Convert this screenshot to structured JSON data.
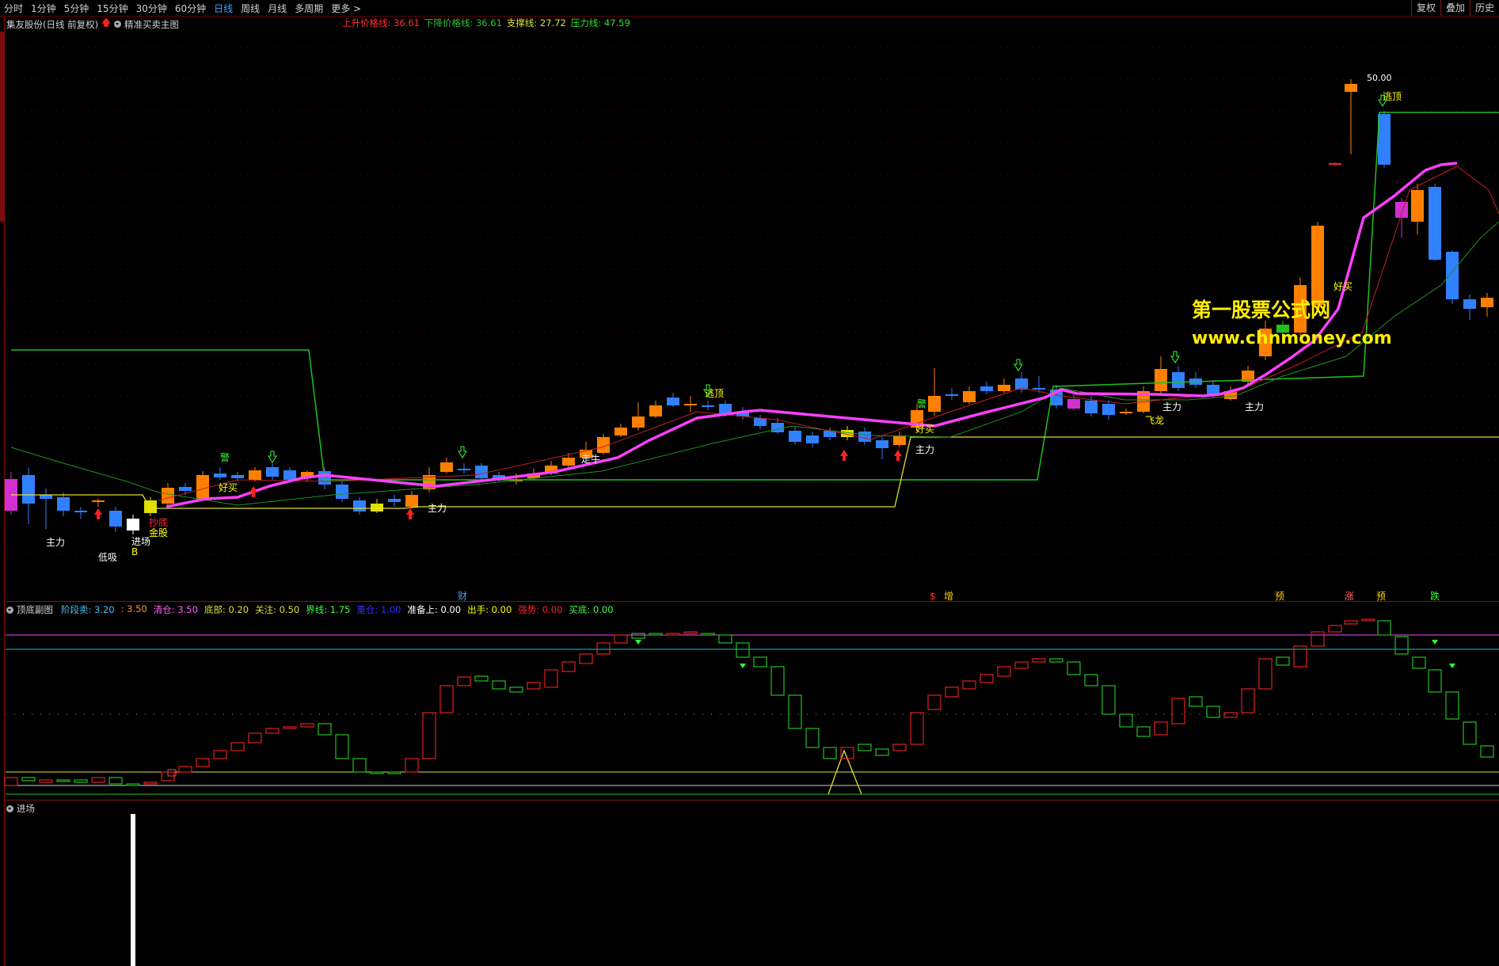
{
  "toolbar": {
    "tabs": [
      "分时",
      "1分钟",
      "5分钟",
      "15分钟",
      "30分钟",
      "60分钟",
      "日线",
      "周线",
      "月线",
      "多周期",
      "更多"
    ],
    "active": "日线",
    "right_buttons": [
      "复权",
      "叠加",
      "历史"
    ]
  },
  "main_panel": {
    "stock": "集友股份(日线 前复权)",
    "indicator": "精准买卖主图",
    "legend": [
      {
        "label": "上升价格线:",
        "value": "36.61",
        "color": "#ff3030"
      },
      {
        "label": "下降价格线:",
        "value": "36.61",
        "color": "#30c030"
      },
      {
        "label": "支撑线:",
        "value": "27.72",
        "color": "#e0e030"
      },
      {
        "label": "压力线:",
        "value": "47.59",
        "color": "#30e030"
      }
    ],
    "price_max_label": "50.00",
    "watermark_name": "第一股票公式网",
    "watermark_url": "www.chnmoney.com",
    "signals": [
      "主力",
      "低吸",
      "进场",
      "B",
      "金股",
      "抄底",
      "好买",
      "走牛",
      "逃顶",
      "主力",
      "好买",
      "主力",
      "飞龙",
      "主力",
      "好买",
      "逃顶",
      "主力",
      "警",
      "警"
    ],
    "bottom_markers": [
      "财",
      "$",
      "增",
      "预",
      "涨",
      "预",
      "跌"
    ]
  },
  "sub_panel": {
    "title": "顶底副图",
    "legend": [
      {
        "label": "阶段卖:",
        "value": "3.20",
        "color": "#40c0ff"
      },
      {
        "label": ":",
        "value": "3.50",
        "color": "#ff9040"
      },
      {
        "label": "清仓:",
        "value": "3.50",
        "color": "#ff60ff"
      },
      {
        "label": "底部:",
        "value": "0.20",
        "color": "#e0e030"
      },
      {
        "label": "关注:",
        "value": "0.50",
        "color": "#e0e030"
      },
      {
        "label": "界线:",
        "value": "1.75",
        "color": "#40ff40"
      },
      {
        "label": "重仓:",
        "value": "1.00",
        "color": "#3030ff"
      },
      {
        "label": "准备上:",
        "value": "0.00",
        "color": "#ffffff"
      },
      {
        "label": "出手:",
        "value": "0.00",
        "color": "#ffff00"
      },
      {
        "label": "强势:",
        "value": "0.00",
        "color": "#ff2020"
      },
      {
        "label": "买底:",
        "value": "0.00",
        "color": "#40ff40"
      }
    ]
  },
  "entry_panel": {
    "title": "进场"
  }
}
